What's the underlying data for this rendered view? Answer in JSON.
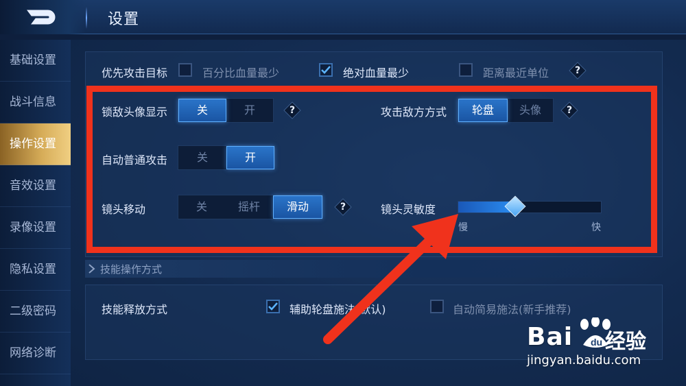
{
  "header": {
    "title": "设置"
  },
  "sidebar": {
    "items": [
      {
        "label": "基础设置",
        "active": false
      },
      {
        "label": "战斗信息",
        "active": false
      },
      {
        "label": "操作设置",
        "active": true
      },
      {
        "label": "音效设置",
        "active": false
      },
      {
        "label": "录像设置",
        "active": false
      },
      {
        "label": "隐私设置",
        "active": false
      },
      {
        "label": "二级密码",
        "active": false
      },
      {
        "label": "网络诊断",
        "active": false
      }
    ]
  },
  "priority_target": {
    "label": "优先攻击目标",
    "options": [
      {
        "label": "百分比血量最少",
        "checked": false
      },
      {
        "label": "绝对血量最少",
        "checked": true
      },
      {
        "label": "距离最近单位",
        "checked": false
      }
    ],
    "help": "?"
  },
  "lock_enemy_avatar": {
    "label": "锁敌头像显示",
    "options": [
      "关",
      "开"
    ],
    "selected": "关",
    "help": "?"
  },
  "attack_enemy_mode": {
    "label": "攻击敌方方式",
    "options": [
      "轮盘",
      "头像"
    ],
    "selected": "轮盘",
    "help": "?"
  },
  "auto_attack": {
    "label": "自动普通攻击",
    "options": [
      "关",
      "开"
    ],
    "selected": "开"
  },
  "camera_move": {
    "label": "镜头移动",
    "options": [
      "关",
      "摇杆",
      "滑动"
    ],
    "selected": "滑动",
    "help": "?"
  },
  "camera_sensitivity": {
    "label": "镜头灵敏度",
    "min_label": "慢",
    "max_label": "快",
    "value": 0.4
  },
  "skill_section": {
    "title": "技能操作方式"
  },
  "skill_release": {
    "label": "技能释放方式",
    "options": [
      {
        "label": "辅助轮盘施法(默认)",
        "checked": true
      },
      {
        "label": "自动简易施法(新手推荐)",
        "checked": false
      }
    ]
  },
  "watermark": {
    "brand": "Bai",
    "brand2": "经验",
    "url": "jingyan.baidu.com"
  },
  "colors": {
    "highlight": "#f0321c",
    "active_tab": "#d7ad59",
    "selected": "#2a74c9"
  }
}
